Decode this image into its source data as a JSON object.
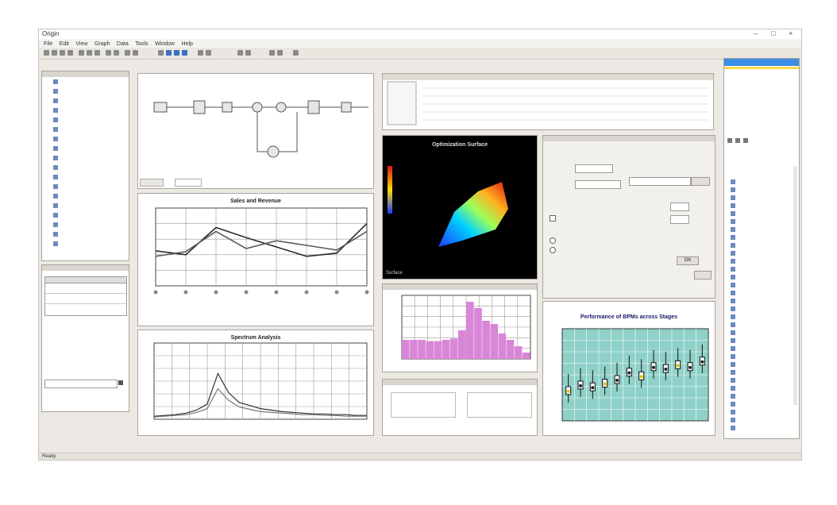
{
  "window": {
    "title": "Origin",
    "min": "‒",
    "max": "□",
    "close": "×"
  },
  "menu": [
    "File",
    "Edit",
    "View",
    "Graph",
    "Data",
    "Tools",
    "Window",
    "Help"
  ],
  "left_tree": {
    "items": [
      "",
      "",
      "",
      "",
      "",
      "",
      "",
      "",
      "",
      "",
      "",
      "",
      "",
      "",
      "",
      "",
      "",
      ""
    ]
  },
  "diagram": {
    "tabs": [
      "",
      ""
    ]
  },
  "line_chart": {
    "title": "Sales and Revenue"
  },
  "spectrum_chart": {
    "title": "Spectrum Analysis"
  },
  "surface_chart": {
    "title": "Optimization Surface",
    "corner": "Surface"
  },
  "histogram": {
    "title": ""
  },
  "box_chart": {
    "title": "Performance of BPMs across Stages"
  },
  "dialog": {
    "title": "",
    "ok": "OK",
    "cancel": ""
  },
  "right_panel": {
    "header": ""
  },
  "statusbar": {
    "text": "Ready"
  },
  "colors": {
    "accent": "#3c8ee6",
    "histogram_bar": "#d986d6",
    "box_bg": "#8fd1c9",
    "surface_bg": "#000000"
  },
  "chart_data": [
    {
      "type": "line",
      "title": "Sales and Revenue",
      "x": [
        1,
        2,
        3,
        4,
        5,
        6,
        7,
        8
      ],
      "series": [
        {
          "values": [
            45,
            40,
            75,
            62,
            50,
            38,
            42,
            80
          ]
        },
        {
          "values": [
            38,
            44,
            70,
            48,
            58,
            52,
            46,
            70
          ]
        }
      ],
      "ylim": [
        0,
        100
      ]
    },
    {
      "type": "line",
      "title": "Spectrum Analysis",
      "x": [
        0,
        1,
        2,
        3,
        4,
        5,
        6,
        7,
        8,
        9,
        10,
        11,
        12,
        13,
        14,
        15,
        16,
        17,
        18,
        19,
        20
      ],
      "series": [
        {
          "values": [
            4,
            5,
            6,
            8,
            12,
            20,
            60,
            35,
            22,
            18,
            14,
            12,
            10,
            9,
            8,
            7,
            7,
            6,
            6,
            5,
            5
          ]
        },
        {
          "values": [
            3,
            4,
            5,
            6,
            9,
            14,
            40,
            25,
            16,
            13,
            10,
            9,
            8,
            7,
            6,
            6,
            5,
            5,
            4,
            4,
            4
          ]
        }
      ],
      "ylim": [
        0,
        100
      ]
    },
    {
      "type": "bar",
      "title": "",
      "values": [
        30,
        30,
        30,
        28,
        28,
        30,
        32,
        45,
        90,
        80,
        60,
        55,
        40,
        30,
        20,
        10
      ],
      "ylim": [
        0,
        100
      ]
    },
    {
      "type": "scatter",
      "title": "Performance of BPMs across Stages",
      "categories": [
        "1",
        "2",
        "3",
        "4",
        "5",
        "6",
        "7",
        "8",
        "9",
        "10",
        "11",
        "12"
      ],
      "values": [
        32,
        38,
        36,
        40,
        44,
        52,
        48,
        58,
        56,
        60,
        58,
        64
      ],
      "ylim": [
        0,
        100
      ]
    }
  ]
}
